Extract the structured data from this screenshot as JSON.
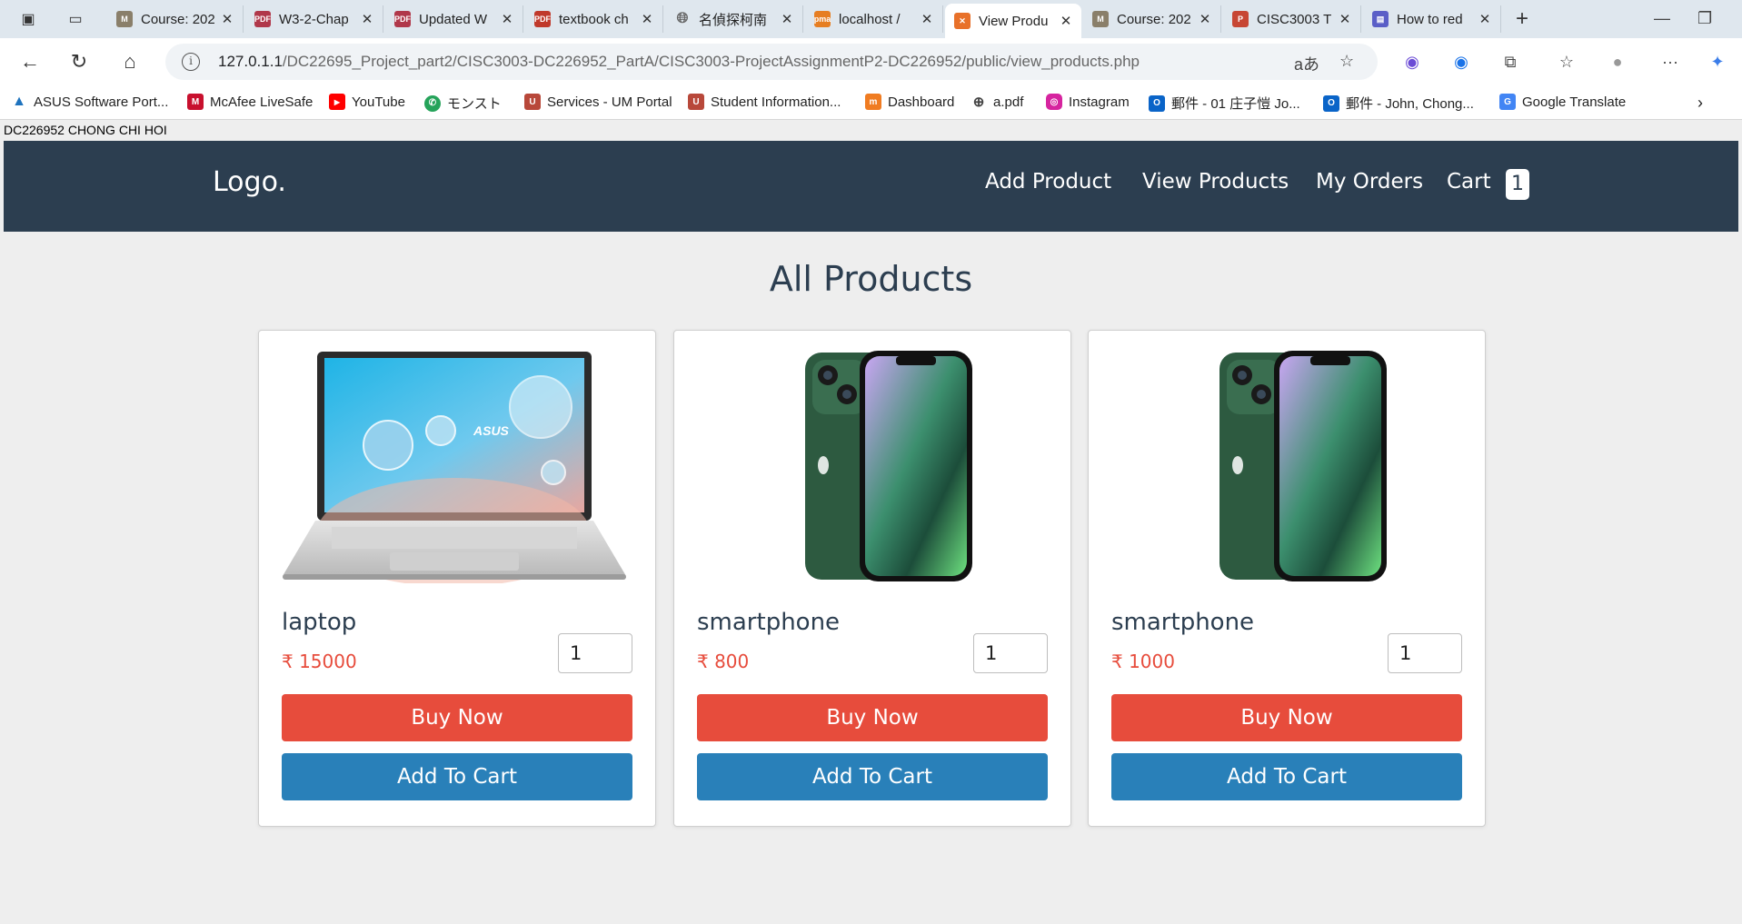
{
  "browser": {
    "tabs": [
      {
        "title": "Course: 202",
        "favicon": "moodle-icon",
        "color": "#8a7f6a"
      },
      {
        "title": "W3-2-Chap",
        "favicon": "pdf-icon",
        "color": "#b0384a"
      },
      {
        "title": "Updated W",
        "favicon": "pdf-icon",
        "color": "#b0384a"
      },
      {
        "title": "textbook ch",
        "favicon": "pdf-icon",
        "color": "#c0392b"
      },
      {
        "title": "名偵探柯南",
        "favicon": "globe-icon",
        "color": "#666666"
      },
      {
        "title": "localhost /",
        "favicon": "phpmyadmin-icon",
        "color": "#e67e22"
      },
      {
        "title": "View Produ",
        "favicon": "xampp-icon",
        "color": "#e8712a",
        "active": true
      },
      {
        "title": "Course: 202",
        "favicon": "moodle-icon",
        "color": "#8a7f6a"
      },
      {
        "title": "CISC3003 T",
        "favicon": "powerpoint-icon",
        "color": "#c74634"
      },
      {
        "title": "How to red",
        "favicon": "chat-icon",
        "color": "#5b5fc7"
      }
    ],
    "url_host": "127.0.1.1",
    "url_path": "/DC22695_Project_part2/CISC3003-DC226952_PartA/CISC3003-ProjectAssignmentP2-DC226952/public/view_products.php",
    "bookmarks": [
      {
        "label": "ASUS Software Port...",
        "icon": "asus-icon",
        "color": "#1e73be"
      },
      {
        "label": "McAfee LiveSafe",
        "icon": "mcafee-icon",
        "color": "#c8102e"
      },
      {
        "label": "YouTube",
        "icon": "youtube-icon",
        "color": "#ff0000"
      },
      {
        "label": "モンスト",
        "icon": "whatsapp-icon",
        "color": "#25a35a"
      },
      {
        "label": "Services - UM Portal",
        "icon": "um-icon",
        "color": "#b8483a"
      },
      {
        "label": "Student Information...",
        "icon": "um-icon",
        "color": "#b8483a"
      },
      {
        "label": "Dashboard",
        "icon": "moodle-icon",
        "color": "#f07c22"
      },
      {
        "label": "a.pdf",
        "icon": "globe-icon",
        "color": "#444444"
      },
      {
        "label": "Instagram",
        "icon": "instagram-icon",
        "color": "#d6249f"
      },
      {
        "label": "郵件 - 01 庄子愷 Jo...",
        "icon": "outlook-icon",
        "color": "#0a64c8"
      },
      {
        "label": "郵件 - John, Chong...",
        "icon": "outlook-icon",
        "color": "#0a64c8"
      },
      {
        "label": "Google Translate",
        "icon": "translate-icon",
        "color": "#4285f4"
      }
    ]
  },
  "page": {
    "student_id": "DC226952 CHONG CHI HOI",
    "logo": "Logo.",
    "nav": {
      "add_product": "Add Product",
      "view_products": "View Products",
      "my_orders": "My Orders",
      "cart": "Cart",
      "cart_count": "1"
    },
    "title": "All Products",
    "currency_symbol": "₹",
    "products": [
      {
        "name": "laptop",
        "price": "₹ 15000",
        "qty": "1",
        "buy_label": "Buy Now",
        "cart_label": "Add To Cart",
        "image": "laptop-image"
      },
      {
        "name": "smartphone",
        "price": "₹ 800",
        "qty": "1",
        "buy_label": "Buy Now",
        "cart_label": "Add To Cart",
        "image": "smartphone-image"
      },
      {
        "name": "smartphone",
        "price": "₹ 1000",
        "qty": "1",
        "buy_label": "Buy Now",
        "cart_label": "Add To Cart",
        "image": "smartphone-image"
      }
    ],
    "colors": {
      "nav_bg": "#2c3e50",
      "buy": "#e74c3c",
      "cart": "#2980b9",
      "price": "#e74c3c"
    }
  }
}
